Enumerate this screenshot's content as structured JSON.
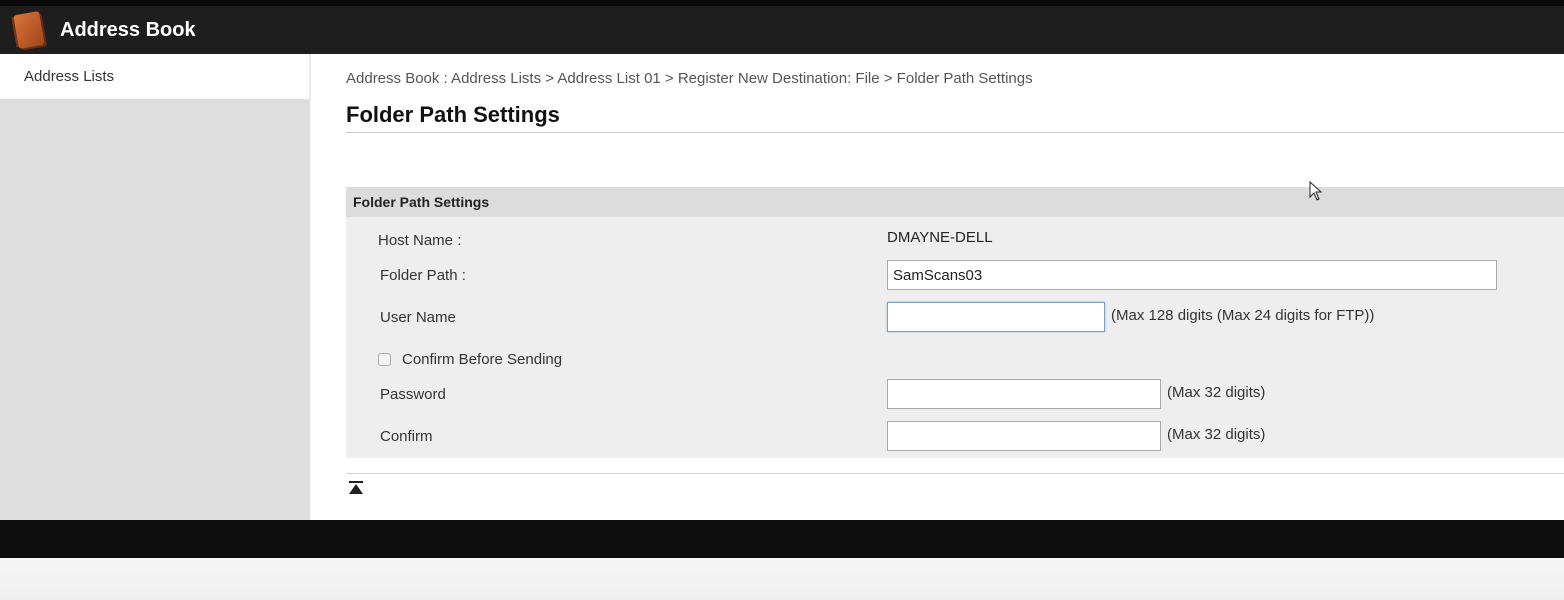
{
  "header": {
    "app_title": "Address Book",
    "icon": "address-book-icon"
  },
  "sidebar": {
    "items": [
      {
        "label": "Address Lists"
      }
    ]
  },
  "breadcrumb": "Address Book : Address Lists > Address List 01 > Register New Destination: File > Folder Path Settings",
  "page_title": "Folder Path Settings",
  "section": {
    "title": "Folder Path Settings",
    "host_name": {
      "label": "Host Name :",
      "value": "DMAYNE-DELL"
    },
    "folder_path": {
      "label": "Folder Path :",
      "value": "SamScans03"
    },
    "user_name": {
      "label": "User Name",
      "value": "",
      "hint": "(Max 128 digits (Max 24 digits for FTP))"
    },
    "confirm_before_sending": {
      "label": "Confirm Before Sending",
      "checked": false
    },
    "password": {
      "label": "Password",
      "value": "",
      "hint": "(Max 32 digits)"
    },
    "confirm": {
      "label": "Confirm",
      "value": "",
      "hint": "(Max 32 digits)"
    }
  },
  "back_to_top_icon": "back-to-top-icon"
}
